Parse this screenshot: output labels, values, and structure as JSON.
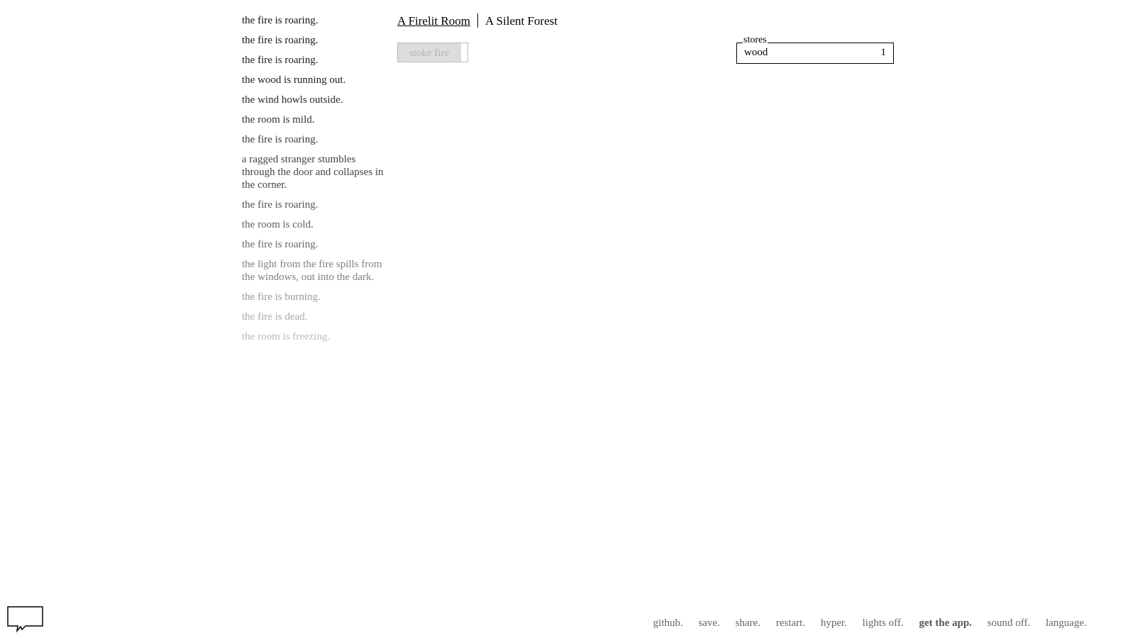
{
  "notifications": [
    {
      "text": "the fire is roaring.",
      "color": "#111111"
    },
    {
      "text": "the fire is roaring.",
      "color": "#161616"
    },
    {
      "text": "the fire is roaring.",
      "color": "#1c1c1c"
    },
    {
      "text": "the wood is running out.",
      "color": "#222222"
    },
    {
      "text": "the wind howls outside.",
      "color": "#2a2a2a"
    },
    {
      "text": "the room is mild.",
      "color": "#333333"
    },
    {
      "text": "the fire is roaring.",
      "color": "#3b3b3b"
    },
    {
      "text": "a ragged stranger stumbles through the door and collapses in the corner.",
      "color": "#444444"
    },
    {
      "text": "the fire is roaring.",
      "color": "#555555"
    },
    {
      "text": "the room is cold.",
      "color": "#5e5e5e"
    },
    {
      "text": "the fire is roaring.",
      "color": "#686868"
    },
    {
      "text": "the light from the fire spills from the windows, out into the dark.",
      "color": "#808080"
    },
    {
      "text": "the fire is burning.",
      "color": "#999999"
    },
    {
      "text": "the fire is dead.",
      "color": "#aaaaaa"
    },
    {
      "text": "the room is freezing.",
      "color": "#bbbbbb"
    }
  ],
  "header": {
    "locations": [
      {
        "label": "A Firelit Room",
        "selected": true
      },
      {
        "label": "A Silent Forest",
        "selected": false
      }
    ]
  },
  "actions": {
    "stoke_fire": {
      "label": "stoke fire",
      "cooldown_fraction": 0.91
    }
  },
  "stores": {
    "legend": "stores",
    "items": [
      {
        "name": "wood",
        "value": "1"
      }
    ]
  },
  "chat_icon": "speech-bubble-icon",
  "footer": {
    "links": [
      {
        "label": "github.",
        "bold": false
      },
      {
        "label": "save.",
        "bold": false
      },
      {
        "label": "share.",
        "bold": false
      },
      {
        "label": "restart.",
        "bold": false
      },
      {
        "label": "hyper.",
        "bold": false
      },
      {
        "label": "lights off.",
        "bold": false
      },
      {
        "label": "get the app.",
        "bold": true
      },
      {
        "label": "sound off.",
        "bold": false
      },
      {
        "label": "language.",
        "bold": false
      }
    ]
  }
}
